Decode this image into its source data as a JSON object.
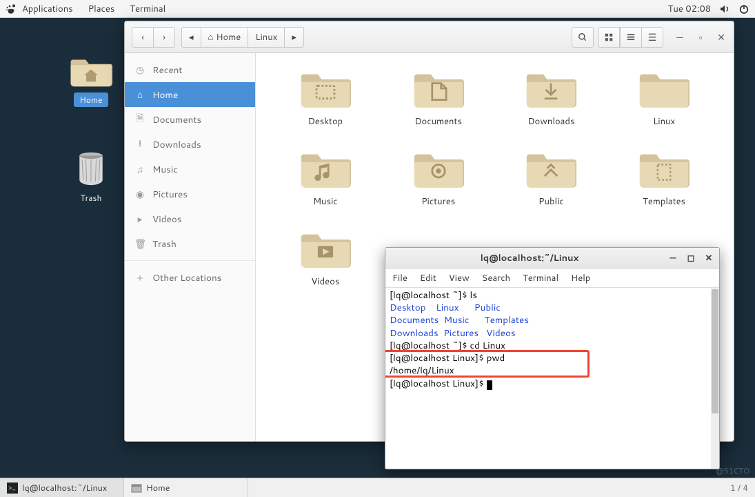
{
  "topbar": {
    "applications": "Applications",
    "places": "Places",
    "terminal": "Terminal",
    "clock": "Tue 02:08"
  },
  "desktop": {
    "home_label": "Home",
    "trash_label": "Trash"
  },
  "filemgr": {
    "path_home": "Home",
    "path_linux": "Linux",
    "sidebar": {
      "recent": "Recent",
      "home": "Home",
      "documents": "Documents",
      "downloads": "Downloads",
      "music": "Music",
      "pictures": "Pictures",
      "videos": "Videos",
      "trash": "Trash",
      "other": "Other Locations"
    },
    "folders": [
      "Desktop",
      "Documents",
      "Downloads",
      "Linux",
      "Music",
      "Pictures",
      "Public",
      "Templates",
      "Videos"
    ],
    "folder_icons": [
      "desktop",
      "documents",
      "downloads",
      "plain",
      "music",
      "pictures",
      "public",
      "templates",
      "videos"
    ]
  },
  "terminal": {
    "title": "lq@localhost:~/Linux",
    "menu": [
      "File",
      "Edit",
      "View",
      "Search",
      "Terminal",
      "Help"
    ],
    "lines": [
      {
        "t": "[lq@localhost ~]$ ls"
      },
      {
        "cols": [
          "Desktop",
          "Linux",
          "Public"
        ],
        "dir": true
      },
      {
        "cols": [
          "Documents",
          "Music",
          "Templates"
        ],
        "dir": true
      },
      {
        "cols": [
          "Downloads",
          "Pictures",
          "Videos"
        ],
        "dir": true
      },
      {
        "t": "[lq@localhost ~]$ cd Linux"
      },
      {
        "t": "[lq@localhost Linux]$ pwd",
        "hl": true
      },
      {
        "t": "/home/lq/Linux",
        "hl": true
      },
      {
        "t": "[lq@localhost Linux]$ ",
        "cursor": true
      }
    ]
  },
  "taskbar": {
    "task1": "lq@localhost:~/Linux",
    "task2": "Home",
    "pager": "1 / 4"
  },
  "watermark": "@51CTO"
}
